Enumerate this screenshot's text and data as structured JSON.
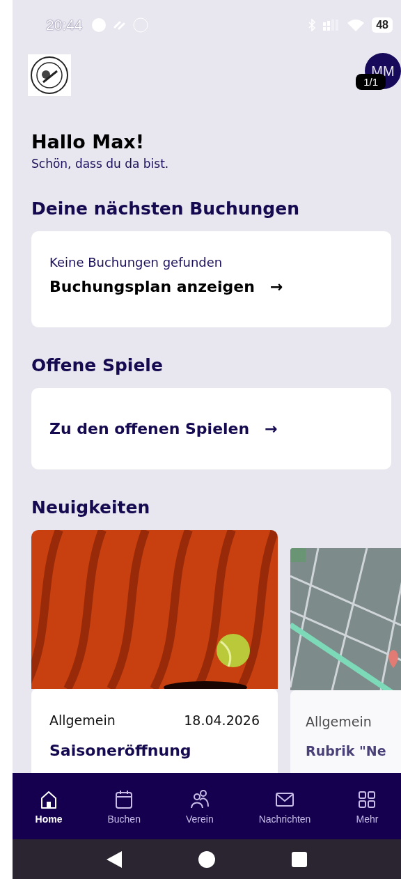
{
  "status_bar": {
    "time": "20:44",
    "battery": "48"
  },
  "header": {
    "avatar_initials": "MM",
    "badge": "1/1"
  },
  "greeting": {
    "title": "Hallo Max!",
    "subtitle": "Schön, dass du da bist."
  },
  "bookings": {
    "heading": "Deine nächsten Buchungen",
    "empty_text": "Keine Buchungen gefunden",
    "link": "Buchungsplan anzeigen",
    "link_icon": "→"
  },
  "open_games": {
    "heading": "Offene Spiele",
    "link": "Zu den offenen Spielen",
    "link_icon": "→"
  },
  "news": {
    "heading": "Neuigkeiten",
    "items": [
      {
        "category": "Allgemein",
        "date": "18.04.2026",
        "title": "Saisoneröffnung"
      },
      {
        "category": "Allgemein",
        "title": "Rubrik \"Ne"
      }
    ]
  },
  "bottom_nav": [
    {
      "label": "Home",
      "selected": true
    },
    {
      "label": "Buchen",
      "selected": false
    },
    {
      "label": "Verein",
      "selected": false
    },
    {
      "label": "Nachrichten",
      "selected": false
    },
    {
      "label": "Mehr",
      "selected": false
    }
  ]
}
